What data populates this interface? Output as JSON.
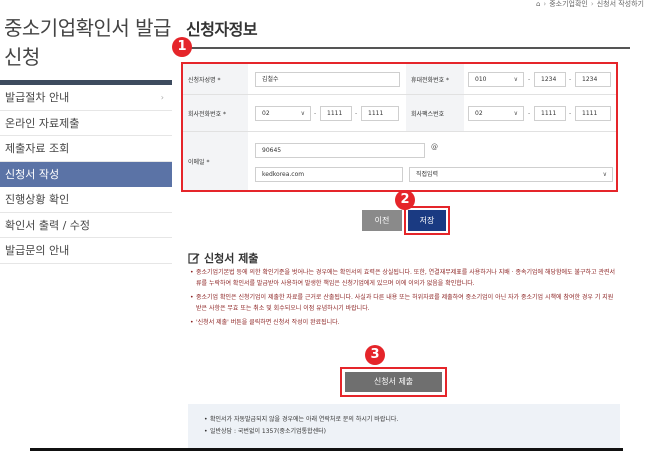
{
  "breadcrumb": {
    "home": "",
    "item1": "중소기업확인",
    "item2": "신청서 작성하기"
  },
  "sidebar": {
    "title": "중소기업확인서 발급신청",
    "items": [
      {
        "label": "발급절차 안내",
        "chevron": "›"
      },
      {
        "label": "온라인 자료제출"
      },
      {
        "label": "제출자료 조회"
      },
      {
        "label": "신청서 작성",
        "active": true
      },
      {
        "label": "진행상황 확인"
      },
      {
        "label": "확인서 출력 / 수정"
      },
      {
        "label": "발급문의 안내"
      }
    ]
  },
  "main": {
    "title": "신청자정보"
  },
  "badges": {
    "b1": "1",
    "b2": "2",
    "b3": "3"
  },
  "form": {
    "applicant_name": {
      "label": "신청자성명 *",
      "value": "김철수"
    },
    "mobile": {
      "label": "휴대전화번호 *",
      "p1": "010",
      "p2": "1234",
      "p3": "1234"
    },
    "office_phone": {
      "label": "회사전화번호 *",
      "p1": "02",
      "p2": "1111",
      "p3": "1111"
    },
    "fax": {
      "label": "회사팩스번호",
      "p1": "02",
      "p2": "1111",
      "p3": "1111"
    },
    "email": {
      "label": "이메일 *",
      "local": "90645",
      "at": "@",
      "domain": "kedkorea.com",
      "domain_select": "직접입력"
    },
    "dash": "-"
  },
  "buttons": {
    "prev": "이전",
    "save": "저장",
    "submit": "신청서 제출"
  },
  "section": {
    "title": "신청서 제출",
    "notes": [
      "중소기업기본법 등에 의한 확인기준을 벗어나는 경우에는 확인서의 효력은 상실됩니다. 또한, 연결재무제표를 사용하거나 지배 · 종속기업에 해당함에도 불구하고 관련서류를 누락하여 확인서를 발급받아 사용하여 발생한 책임은 신청기업에게 있으며 이에 이의가 없음을 확인합니다.",
      "중소기업 확인은 신청기업이 제출한 자료를 근거로 산출됩니다. 사실과 다른 내용 또는 허위자료를 제출하여 중소기업이 아닌 자가 중소기업 시책에 참여한 경우 기 지원 받은 사항은 무효 또는 취소 및 회수되오니 이점 유념하시기 바랍니다.",
      "'신청서 제출' 버튼을 클릭하면 신청서 작성이 완료됩니다."
    ]
  },
  "info": [
    "확인서가 자동발급되지 않을 경우에는 아래 연락처로 문의 하시기 바랍니다.",
    "일반상담 : 국번없이 1357(중소기업통합센터)"
  ],
  "colors": {
    "accent_red": "#e5252a",
    "navy": "#1a3a82",
    "sidebar_active": "#5b73a6"
  }
}
